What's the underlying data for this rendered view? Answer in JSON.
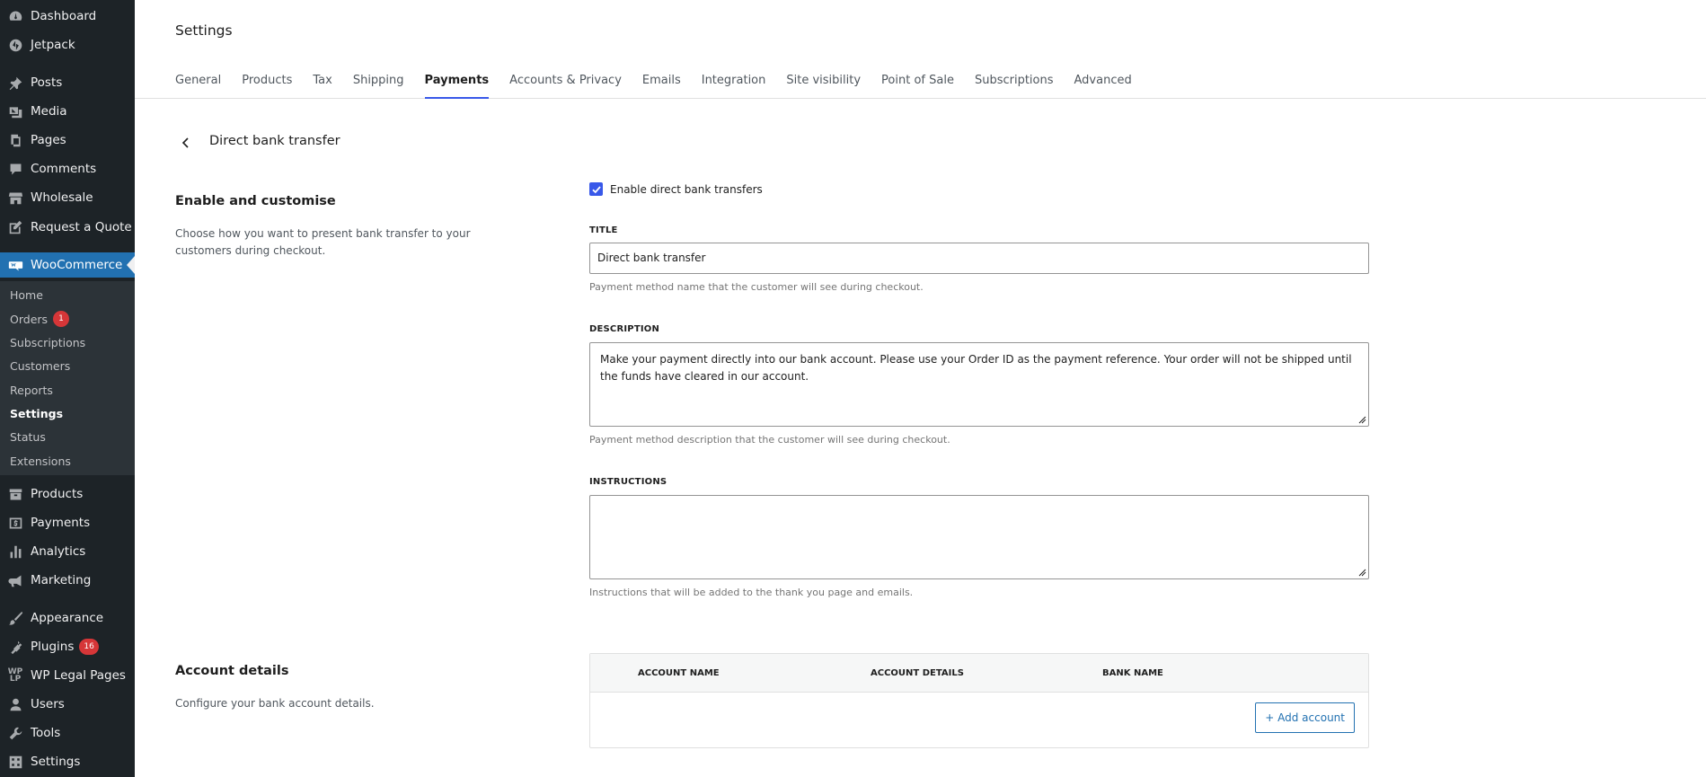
{
  "sidebar": {
    "top_items": [
      {
        "label": "Dashboard",
        "icon": "dashboard-icon"
      },
      {
        "label": "Jetpack",
        "icon": "jetpack-icon"
      },
      {
        "label": "Posts",
        "icon": "pin-icon"
      },
      {
        "label": "Media",
        "icon": "media-icon"
      },
      {
        "label": "Pages",
        "icon": "pages-icon"
      },
      {
        "label": "Comments",
        "icon": "comment-icon"
      },
      {
        "label": "Wholesale",
        "icon": "store-icon"
      },
      {
        "label": "Request a Quote",
        "icon": "edit-icon"
      },
      {
        "label": "WooCommerce",
        "icon": "woocommerce-icon"
      }
    ],
    "woo_submenu": [
      {
        "label": "Home"
      },
      {
        "label": "Orders",
        "badge": "1"
      },
      {
        "label": "Subscriptions"
      },
      {
        "label": "Customers"
      },
      {
        "label": "Reports"
      },
      {
        "label": "Settings"
      },
      {
        "label": "Status"
      },
      {
        "label": "Extensions"
      }
    ],
    "bottom_items": [
      {
        "label": "Products",
        "icon": "archive-icon"
      },
      {
        "label": "Payments",
        "icon": "money-icon"
      },
      {
        "label": "Analytics",
        "icon": "chart-bar-icon"
      },
      {
        "label": "Marketing",
        "icon": "megaphone-icon"
      },
      {
        "label": "Appearance",
        "icon": "brush-icon"
      },
      {
        "label": "Plugins",
        "icon": "plugin-icon",
        "badge": "16"
      },
      {
        "label": "WP Legal Pages",
        "icon": "wp-legal-pages-icon"
      },
      {
        "label": "Users",
        "icon": "user-icon"
      },
      {
        "label": "Tools",
        "icon": "wrench-icon"
      },
      {
        "label": "Settings",
        "icon": "settings-icon"
      }
    ]
  },
  "header": {
    "title": "Settings",
    "tabs": [
      {
        "label": "General"
      },
      {
        "label": "Products"
      },
      {
        "label": "Tax"
      },
      {
        "label": "Shipping"
      },
      {
        "label": "Payments",
        "active": true
      },
      {
        "label": "Accounts & Privacy"
      },
      {
        "label": "Emails"
      },
      {
        "label": "Integration"
      },
      {
        "label": "Site visibility"
      },
      {
        "label": "Point of Sale"
      },
      {
        "label": "Subscriptions"
      },
      {
        "label": "Advanced"
      }
    ]
  },
  "main": {
    "method_title": "Direct bank transfer",
    "enable_section": {
      "heading": "Enable and customise",
      "description": "Choose how you want to present bank transfer to your customers during checkout."
    },
    "enable_checkbox": {
      "label": "Enable direct bank transfers",
      "checked": true
    },
    "title_field": {
      "label": "TITLE",
      "value": "Direct bank transfer",
      "help": "Payment method name that the customer will see during checkout."
    },
    "description_field": {
      "label": "DESCRIPTION",
      "value": "Make your payment directly into our bank account. Please use your Order ID as the payment reference. Your order will not be shipped until the funds have cleared in our account.",
      "help": "Payment method description that the customer will see during checkout."
    },
    "instructions_field": {
      "label": "INSTRUCTIONS",
      "value": "",
      "help": "Instructions that will be added to the thank you page and emails."
    },
    "account_section": {
      "heading": "Account details",
      "description": "Configure your bank account details."
    },
    "accounts_table": {
      "columns": [
        "ACCOUNT NAME",
        "ACCOUNT DETAILS",
        "BANK NAME"
      ],
      "add_button": "+ Add account"
    }
  },
  "colors": {
    "sidebar_bg": "#1d2327",
    "submenu_bg": "#2c3338",
    "wp_blue": "#2271b1",
    "accent": "#3858e9",
    "badge_red": "#d63638"
  }
}
